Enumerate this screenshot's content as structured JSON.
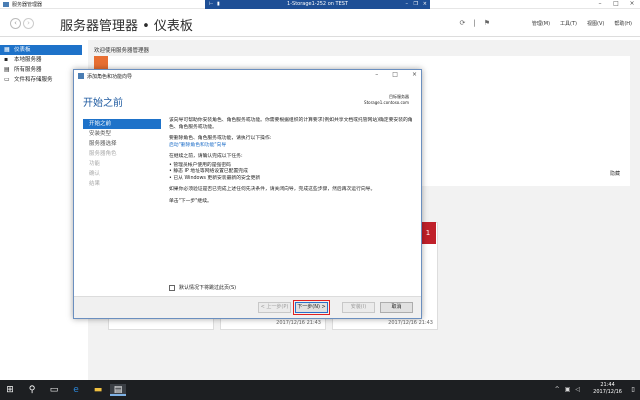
{
  "app": {
    "window_title": "服务器管理器",
    "remote_title": "1-Storage1-252 on TEST",
    "page_title": "服务器管理器 • 仪表板"
  },
  "header_menu": [
    "管理(M)",
    "工具(T)",
    "视图(V)",
    "帮助(H)"
  ],
  "sidebar": {
    "items": [
      {
        "label": "仪表板",
        "icon": "dashboard-icon"
      },
      {
        "label": "本地服务器",
        "icon": "server-icon"
      },
      {
        "label": "所有服务器",
        "icon": "servers-icon"
      },
      {
        "label": "文件和存储服务",
        "icon": "storage-icon"
      }
    ]
  },
  "dashboard": {
    "welcome": "欢迎使用服务器管理器",
    "hide": "隐藏",
    "red_tile_count": "1",
    "tile_times": [
      "2017/12/16 21:43",
      "2017/12/16 21:43"
    ]
  },
  "wizard": {
    "title": "添加角色和功能向导",
    "heading": "开始之前",
    "server_label": "目标服务器",
    "server_name": "Storage1.contoso.com",
    "steps": [
      "开始之前",
      "安装类型",
      "服务器选择",
      "服务器角色",
      "功能",
      "确认",
      "结果"
    ],
    "para1": "该向导可帮助你安装角色、角色服务或功能。你需要根据组织的计算要求(例如共享文档或托管网站)确定要安装的角色、角色服务或功能。",
    "para2": "要删除角色、角色服务或功能，请执行以下操作:",
    "para2_link": "启动\"删除角色和功能\"向导",
    "para3": "在继续之前，请确认完成以下任务:",
    "bullets": [
      "• 管理员帐户使用的是强密码",
      "• 静态 IP 地址等网络设置已配置完成",
      "• 已从 Windows 更新安装最新的安全更新"
    ],
    "para4": "如果你必须验证是否已完成上述任何先决条件，请关闭向导，完成这些步骤，然后再次运行向导。",
    "para5": "单击\"下一步\"继续。",
    "skip_label": "默认情况下将跳过此页(S)",
    "buttons": {
      "prev": "< 上一步(P)",
      "next": "下一步(N) >",
      "install": "安装(I)",
      "cancel": "取消"
    }
  },
  "taskbar": {
    "time": "21:44",
    "date": "2017/12/16"
  }
}
